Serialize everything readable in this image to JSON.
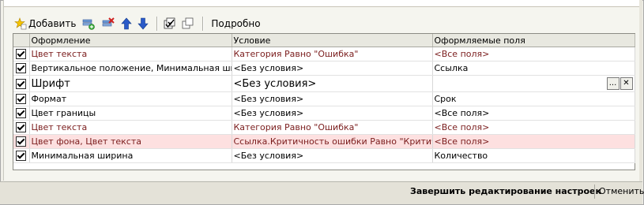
{
  "toolbar": {
    "add_label": "Добавить",
    "more_label": "Подробно"
  },
  "columns": [
    "Оформление",
    "Условие",
    "Оформляемые поля"
  ],
  "rows": [
    {
      "checked": true,
      "appearance": "Цвет текста",
      "condition": "Категория Равно \"Ошибка\"",
      "fields": "<Все поля>",
      "red": true
    },
    {
      "checked": true,
      "appearance": "Вертикальное положение, Минимальная шири...",
      "condition": "<Без условия>",
      "fields": "Ссылка",
      "red": false
    },
    {
      "checked": true,
      "appearance": "Шрифт",
      "condition": "<Без условия>",
      "fields": "",
      "red": false,
      "editing": true
    },
    {
      "checked": true,
      "appearance": "Формат",
      "condition": "<Без условия>",
      "fields": "Срок",
      "red": false
    },
    {
      "checked": true,
      "appearance": "Цвет границы",
      "condition": "<Без условия>",
      "fields": "<Все поля>",
      "red": false
    },
    {
      "checked": true,
      "appearance": "Цвет текста",
      "condition": "Категория Равно \"Ошибка\"",
      "fields": "<Все поля>",
      "red": true
    },
    {
      "checked": true,
      "appearance": "Цвет фона, Цвет текста",
      "condition": "Ссылка.Критичность ошибки Равно \"Критичная\"",
      "fields": "<Все поля>",
      "red": true,
      "highlight": true
    },
    {
      "checked": true,
      "appearance": "Минимальная ширина",
      "condition": "<Без условия>",
      "fields": "Количество",
      "red": false
    }
  ],
  "edit_buttons": {
    "select": "...",
    "clear": "✕"
  },
  "footer": {
    "finish_label": "Завершить редактирование настроек",
    "cancel_label": "Отменить"
  },
  "colors": {
    "highlight_row": "#fde0e0",
    "red_text": "#7a1c1c"
  }
}
